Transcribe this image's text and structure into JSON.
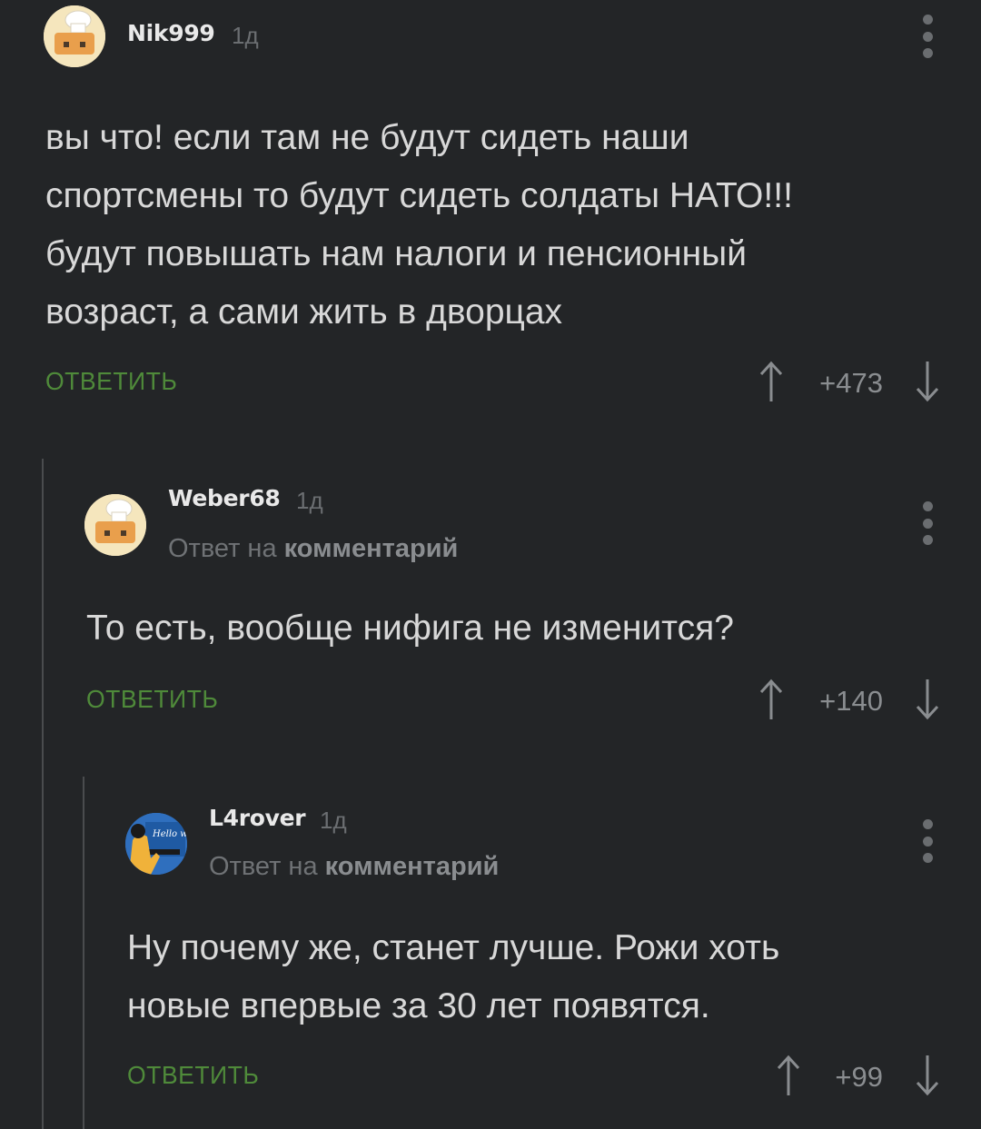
{
  "comments": [
    {
      "username": "Nik999",
      "time": "1д",
      "text_lines": [
        "вы что! если там не будут сидеть наши",
        "спортсмены то будут сидеть солдаты НАТО!!!",
        "будут повышать нам налоги и пенсионный",
        "возраст, а сами жить в дворцах"
      ],
      "reply_label": "ОТВЕТИТЬ",
      "rating": "+473"
    },
    {
      "username": "Weber68",
      "time": "1д",
      "reply_to_prefix": "Ответ на",
      "reply_to_target": "комментарий",
      "text_lines": [
        "То есть, вообще нифига не изменится?"
      ],
      "reply_label": "ОТВЕТИТЬ",
      "rating": "+140"
    },
    {
      "username": "L4rover",
      "time": "1д",
      "reply_to_prefix": "Ответ на",
      "reply_to_target": "комментарий",
      "text_lines": [
        "Ну почему же, станет лучше. Рожи хоть",
        "новые впервые за 30 лет появятся."
      ],
      "reply_label": "ОТВЕТИТЬ",
      "rating": "+99",
      "avatar_text": "Hello world"
    }
  ],
  "colors": {
    "background": "#232527",
    "accent_green": "#4f8a3a",
    "text": "#d8d8d8",
    "muted": "#6b6e71"
  },
  "icons": [
    "menu-dots-icon",
    "arrow-up-icon",
    "arrow-down-icon"
  ]
}
